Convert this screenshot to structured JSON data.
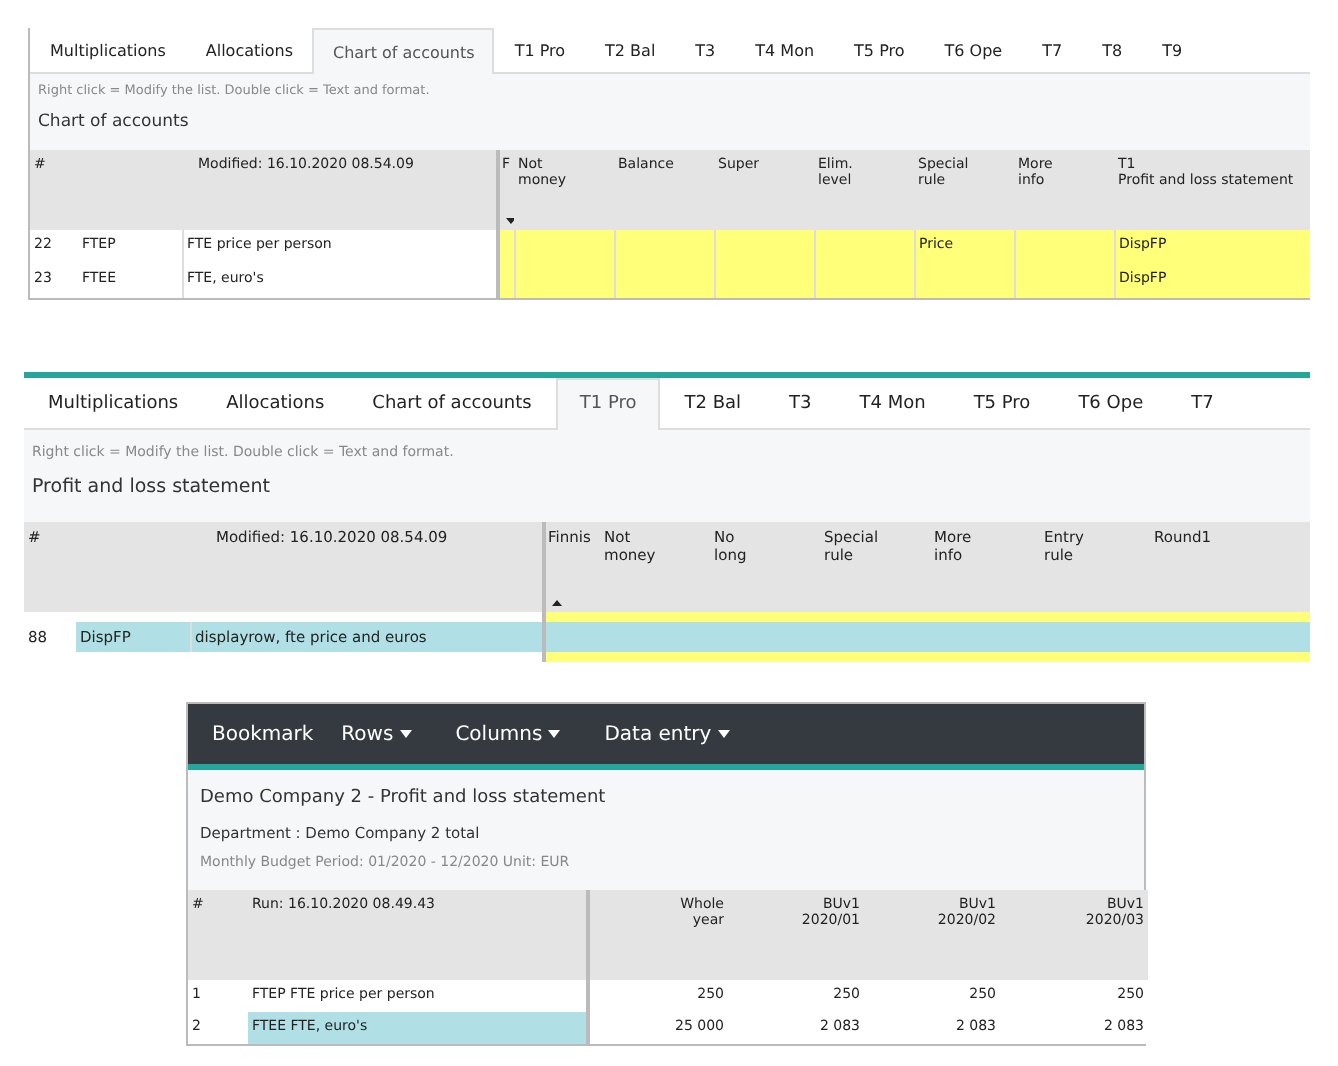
{
  "panels": [
    {
      "kind": "editor",
      "tabs": [
        {
          "label": "Multiplications",
          "selected": false
        },
        {
          "label": "Allocations",
          "selected": false
        },
        {
          "label": "Chart of accounts",
          "selected": true
        },
        {
          "label": "T1 Pro",
          "selected": false
        },
        {
          "label": "T2 Bal",
          "selected": false
        },
        {
          "label": "T3",
          "selected": false
        },
        {
          "label": "T4 Mon",
          "selected": false
        },
        {
          "label": "T5 Pro",
          "selected": false
        },
        {
          "label": "T6 Ope",
          "selected": false
        },
        {
          "label": "T7",
          "selected": false
        },
        {
          "label": "T8",
          "selected": false
        },
        {
          "label": "T9",
          "selected": false
        }
      ],
      "hint": "Right click = Modify the list. Double click = Text and format.",
      "title": "Chart of accounts",
      "number_header": "#",
      "modified": "Modified: 16.10.2020 08.54.09",
      "columns": [
        {
          "label": "F",
          "sorted": true,
          "descending": true
        },
        {
          "label": "Not\nmoney",
          "sorted": false
        },
        {
          "label": "Balance",
          "sorted": false
        },
        {
          "label": "Super",
          "sorted": false
        },
        {
          "label": "Elim.\nlevel",
          "sorted": false
        },
        {
          "label": "Special\nrule",
          "sorted": false
        },
        {
          "label": "More\ninfo",
          "sorted": false
        },
        {
          "label": "T1\nProfit and loss statement",
          "sorted": false
        }
      ],
      "rows": [
        {
          "number": "22",
          "code": "FTEP",
          "name": "FTE price per person",
          "selected": false,
          "cells": {
            "5": "Price",
            "7": "DispFP"
          }
        },
        {
          "number": "23",
          "code": "FTEE",
          "name": "FTE, euro's",
          "selected": false,
          "cells": {
            "7": "DispFP"
          }
        }
      ]
    },
    {
      "kind": "editor",
      "tabs": [
        {
          "label": "Multiplications",
          "selected": false
        },
        {
          "label": "Allocations",
          "selected": false
        },
        {
          "label": "Chart of accounts",
          "selected": false
        },
        {
          "label": "T1 Pro",
          "selected": true
        },
        {
          "label": "T2 Bal",
          "selected": false
        },
        {
          "label": "T3",
          "selected": false
        },
        {
          "label": "T4 Mon",
          "selected": false
        },
        {
          "label": "T5 Pro",
          "selected": false
        },
        {
          "label": "T6 Ope",
          "selected": false
        },
        {
          "label": "T7",
          "selected": false
        }
      ],
      "hint": "Right click = Modify the list. Double click = Text and format.",
      "title": "Profit and loss statement",
      "number_header": "#",
      "modified": "Modified: 16.10.2020 08.54.09",
      "columns": [
        {
          "label": "Finnis",
          "sorted": true,
          "descending": false
        },
        {
          "label": "Not\nmoney",
          "sorted": false
        },
        {
          "label": "No\nlong",
          "sorted": false
        },
        {
          "label": "Special\nrule",
          "sorted": false
        },
        {
          "label": "More\ninfo",
          "sorted": false
        },
        {
          "label": "Entry\nrule",
          "sorted": false
        },
        {
          "label": "Round1",
          "sorted": false
        }
      ],
      "rows": [
        {
          "number": "88",
          "code": "DispFP",
          "name": "displayrow, fte price and euros",
          "selected": true,
          "cells": {}
        }
      ]
    },
    {
      "kind": "report",
      "menu": [
        {
          "label": "Bookmark",
          "dropdown": false
        },
        {
          "label": "Rows",
          "dropdown": true
        },
        {
          "label": "Columns",
          "dropdown": true
        },
        {
          "label": "Data entry",
          "dropdown": true
        }
      ],
      "title": "Demo Company 2 - Profit and loss statement",
      "department": "Department : Demo Company 2 total",
      "period": "Monthly Budget Period: 01/2020 - 12/2020 Unit: EUR",
      "number_header": "#",
      "run": "Run: 16.10.2020 08.49.43",
      "columns": [
        "Whole\nyear",
        "BUv1\n2020/01",
        "BUv1\n2020/02",
        "BUv1\n2020/03"
      ],
      "rows": [
        {
          "number": "1",
          "name": "FTEP FTE price per person",
          "selected": false,
          "values": [
            "250",
            "250",
            "250",
            "250"
          ]
        },
        {
          "number": "2",
          "name": "FTEE FTE, euro's",
          "selected": true,
          "values": [
            "25 000",
            "2 083",
            "2 083",
            "2 083"
          ]
        }
      ]
    }
  ]
}
